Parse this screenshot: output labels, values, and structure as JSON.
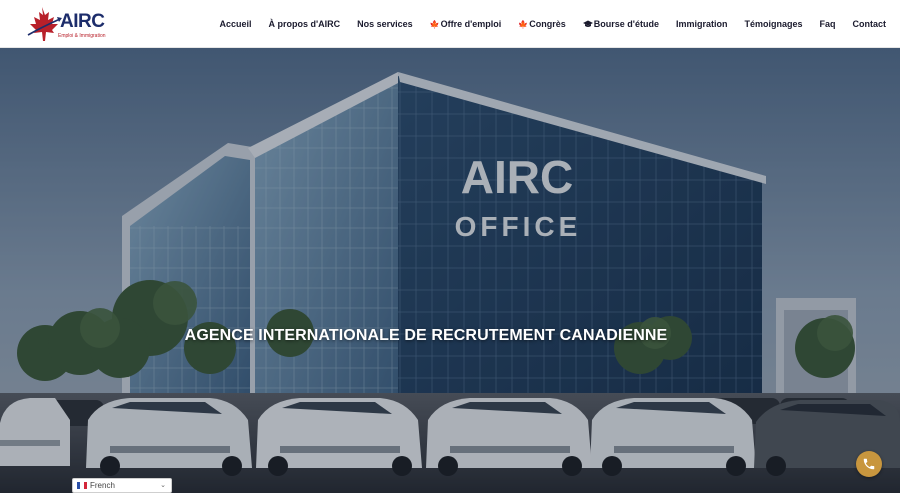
{
  "logo": {
    "name": "AIRC",
    "tagline": "Emploi & Immigration"
  },
  "nav": {
    "items": [
      {
        "label": "Accueil",
        "icon": ""
      },
      {
        "label": "À propos d'AIRC",
        "icon": ""
      },
      {
        "label": "Nos services",
        "icon": ""
      },
      {
        "label": "Offre d'emploi",
        "icon": "maple-leaf-icon"
      },
      {
        "label": "Congrès",
        "icon": "maple-leaf-icon"
      },
      {
        "label": "Bourse d'étude",
        "icon": "graduation-cap-icon"
      },
      {
        "label": "Immigration",
        "icon": ""
      },
      {
        "label": "Témoignages",
        "icon": ""
      },
      {
        "label": "Faq",
        "icon": ""
      },
      {
        "label": "Contact",
        "icon": ""
      }
    ]
  },
  "hero": {
    "sign_line1": "AIRC",
    "sign_line2": "OFFICE",
    "title": "AGENCE INTERNATIONALE DE RECRUTEMENT CANADIENNE"
  },
  "language": {
    "selected": "French"
  },
  "colors": {
    "brand_navy": "#1d2d6b",
    "brand_red": "#b8202a",
    "phone_button": "#c8963e"
  }
}
